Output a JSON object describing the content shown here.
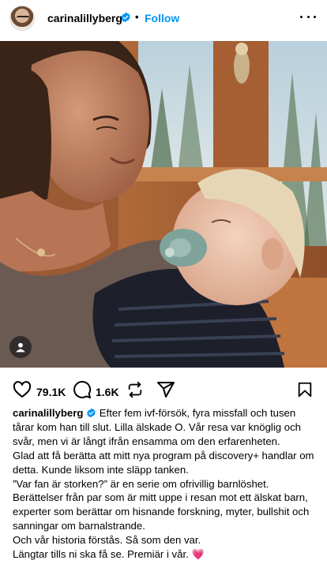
{
  "post": {
    "username": "carinalillyberg",
    "separator": "•",
    "follow_label": "Follow"
  },
  "actions": {
    "likes": "79.1K",
    "comments": "1.6K"
  },
  "caption": {
    "username": "carinalillyberg",
    "lines": [
      "Efter fem ivf-försök, fyra missfall och tusen tårar kom han till slut. Lilla älskade O. Vår resa var knöglig och svår, men vi är långt ifrån ensamma om den erfarenheten.",
      "Glad att få berätta att mitt nya program på discovery+ handlar om detta. Kunde liksom inte släpp tanken.",
      "”Var fan är storken?” är en serie om ofrivillig barnlöshet. Berättelser från par som är mitt uppe i resan mot ett älskat barn, experter som berättar om hisnande forskning, myter, bullshit och sanningar om barnalstrande.",
      "Och vår historia förstås. Så som den var.",
      "Längtar tills ni ska få se. Premiär i vår. 💗"
    ]
  },
  "icons": {
    "verified": "verified-badge-icon",
    "more": "more-options-icon",
    "like": "heart-icon",
    "comment": "comment-bubble-icon",
    "repost": "repost-icon",
    "share": "send-icon",
    "save": "bookmark-icon",
    "tag": "user-tag-icon"
  },
  "colors": {
    "follow": "#0095f6",
    "verified": "#0095f6",
    "heart_emoji": "#e84d7a"
  }
}
